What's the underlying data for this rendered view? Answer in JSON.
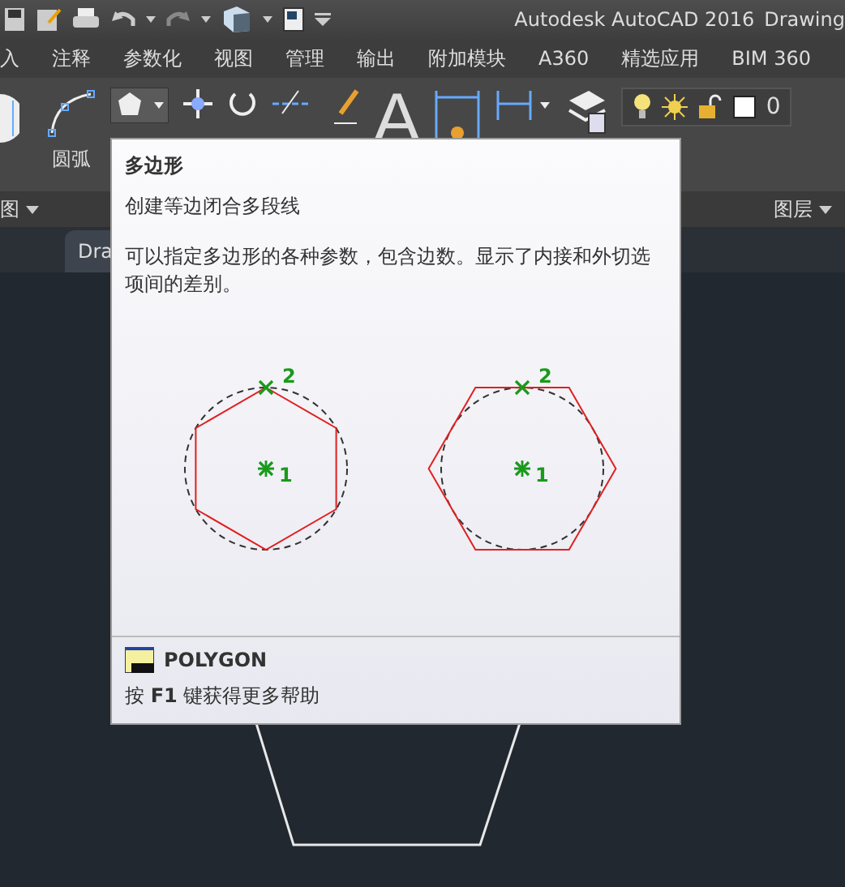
{
  "window": {
    "title": "Autodesk AutoCAD 2016",
    "document": "Drawing"
  },
  "menu_tabs": [
    {
      "label": "入"
    },
    {
      "label": "注释"
    },
    {
      "label": "参数化"
    },
    {
      "label": "视图"
    },
    {
      "label": "管理"
    },
    {
      "label": "输出"
    },
    {
      "label": "附加模块"
    },
    {
      "label": "A360"
    },
    {
      "label": "精选应用"
    },
    {
      "label": "BIM 360"
    }
  ],
  "ribbon": {
    "arc_label": "圆弧",
    "text_glyph": "A",
    "layer_value": "0",
    "panels": [
      {
        "title": "图"
      },
      {
        "title": "图层"
      }
    ]
  },
  "document_tabs": [
    {
      "label": "Dra"
    }
  ],
  "tooltip": {
    "title": "多边形",
    "summary": "创建等边闭合多段线",
    "description": "可以指定多边形的各种参数，包含边数。显示了内接和外切选项间的差别。",
    "diagrams": [
      {
        "kind": "inscribed",
        "center_label": "1",
        "point_label": "2"
      },
      {
        "kind": "circumscribed",
        "center_label": "1",
        "point_label": "2"
      }
    ],
    "command": "POLYGON",
    "help": "按 **F1** 键获得更多帮助"
  }
}
